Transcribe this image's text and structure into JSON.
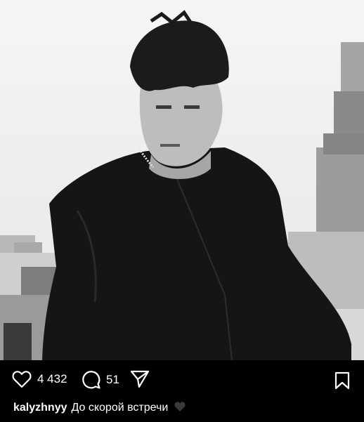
{
  "post": {
    "image_alt": "Black and white portrait of a young man in a black hoodie on a rooftop, city skyline with a tall tower behind",
    "likes": "4 432",
    "comments": "51"
  },
  "caption": {
    "username": "kalyzhnyy",
    "text": "До скорой встречи",
    "emoji": "black heart"
  },
  "icons": {
    "like": "heart-icon",
    "comment": "comment-icon",
    "share": "send-icon",
    "save": "bookmark-icon"
  },
  "colors": {
    "background": "#000000",
    "text": "#ffffff"
  }
}
